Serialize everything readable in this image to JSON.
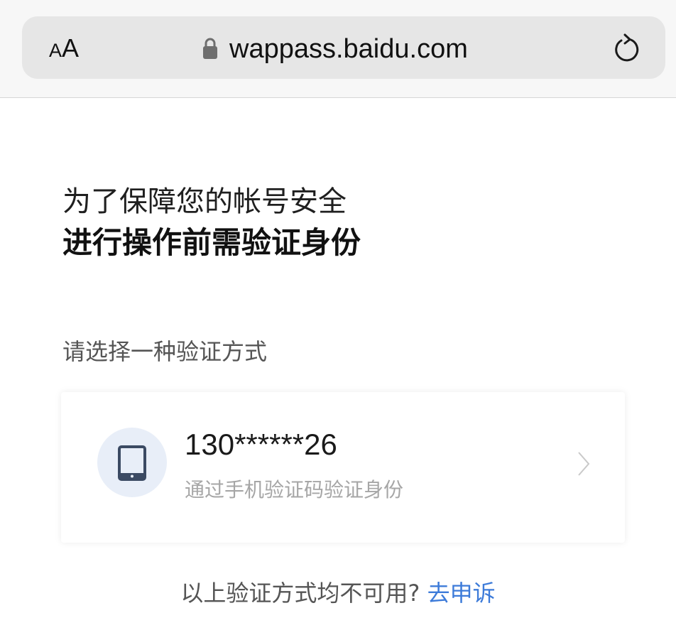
{
  "browser": {
    "reader_small": "A",
    "reader_big": "A",
    "url": "wappass.baidu.com"
  },
  "heading": {
    "line1": "为了保障您的帐号安全",
    "line2": "进行操作前需验证身份"
  },
  "prompt": "请选择一种验证方式",
  "method": {
    "phone": "130******26",
    "description": "通过手机验证码验证身份",
    "icon": "mobile-phone-icon"
  },
  "footer": {
    "question": "以上验证方式均不可用?",
    "link": "去申诉"
  },
  "colors": {
    "link": "#3d7bd9",
    "icon_bg": "#e8eef8",
    "icon": "#3b4a63"
  }
}
